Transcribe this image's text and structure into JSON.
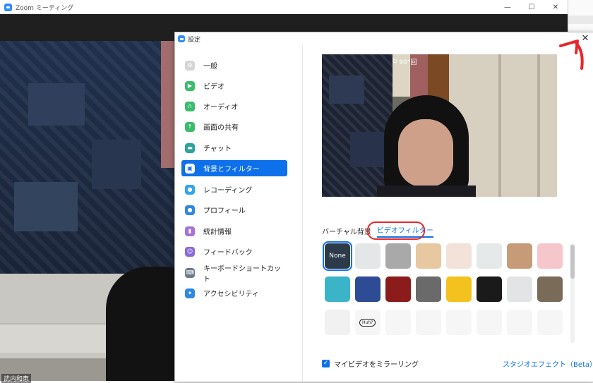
{
  "main_window": {
    "title": "Zoom ミーティング",
    "participant_name": "武内和恵"
  },
  "settings": {
    "title": "設定",
    "close_label": "✕",
    "nav": [
      {
        "label": "一般",
        "icon": "gear-icon",
        "color": "#d5d5d5",
        "active": false
      },
      {
        "label": "ビデオ",
        "icon": "video-camera-icon",
        "color": "#3bbc6e",
        "active": false
      },
      {
        "label": "オーディオ",
        "icon": "headphones-icon",
        "color": "#3bbc6e",
        "active": false
      },
      {
        "label": "画面の共有",
        "icon": "screen-share-icon",
        "color": "#3bbc6e",
        "active": false
      },
      {
        "label": "チャット",
        "icon": "chat-bubble-icon",
        "color": "#2ba59c",
        "active": false
      },
      {
        "label": "背景とフィルター",
        "icon": "portrait-icon",
        "color": "#0e71eb",
        "active": true
      },
      {
        "label": "レコーディング",
        "icon": "record-icon",
        "color": "#2fa7ea",
        "active": false
      },
      {
        "label": "プロフィール",
        "icon": "person-icon",
        "color": "#2f88e0",
        "active": false
      },
      {
        "label": "統計情報",
        "icon": "bar-chart-icon",
        "color": "#a574d4",
        "active": false
      },
      {
        "label": "フィードバック",
        "icon": "smiley-icon",
        "color": "#8a6bd6",
        "active": false
      },
      {
        "label": "キーボードショートカット",
        "icon": "keyboard-icon",
        "color": "#6f7b8b",
        "active": false
      },
      {
        "label": "アクセシビリティ",
        "icon": "accessibility-icon",
        "color": "#2f88e0",
        "active": false
      }
    ],
    "preview": {
      "rotate_label": "90°回"
    },
    "tabs": {
      "virtual_background": "バーチャル背景",
      "video_filter": "ビデオフィルター"
    },
    "filters": [
      {
        "name": "None",
        "bg": "#2d3a4a"
      },
      {
        "name": "",
        "bg": "#e4e6e8"
      },
      {
        "name": "",
        "bg": "#a9a9a9"
      },
      {
        "name": "",
        "bg": "#e7c8a0"
      },
      {
        "name": "",
        "bg": "#f2e2da"
      },
      {
        "name": "",
        "bg": "#e5e9ea"
      },
      {
        "name": "",
        "bg": "#c69c78"
      },
      {
        "name": "",
        "bg": "#f6c6cd"
      },
      {
        "name": "",
        "bg": "#3bb4c7"
      },
      {
        "name": "",
        "bg": "#2e4c96"
      },
      {
        "name": "",
        "bg": "#8c1c1c"
      },
      {
        "name": "",
        "bg": "#6a6a6a"
      },
      {
        "name": "",
        "bg": "#f4c21e"
      },
      {
        "name": "",
        "bg": "#1a1a1a"
      },
      {
        "name": "",
        "bg": "#e2e4e6"
      },
      {
        "name": "",
        "bg": "#7a6a58"
      },
      {
        "name": "",
        "bg": "#f1f1f1"
      },
      {
        "name": "Huh?",
        "bg": "#f6f6f6"
      },
      {
        "name": "",
        "bg": "#f6f6f6"
      },
      {
        "name": "",
        "bg": "#f6f6f6"
      },
      {
        "name": "",
        "bg": "#f6f6f6"
      },
      {
        "name": "",
        "bg": "#f6f6f6"
      },
      {
        "name": "",
        "bg": "#f6f6f6"
      },
      {
        "name": "",
        "bg": "#f6f6f6"
      }
    ],
    "mirror_label": "マイビデオをミラーリング",
    "mirror_checked": true,
    "studio_effects_label": "スタジオエフェクト（Beta）"
  },
  "colors": {
    "accent": "#0e71eb",
    "annotation_red": "#e8262a"
  }
}
